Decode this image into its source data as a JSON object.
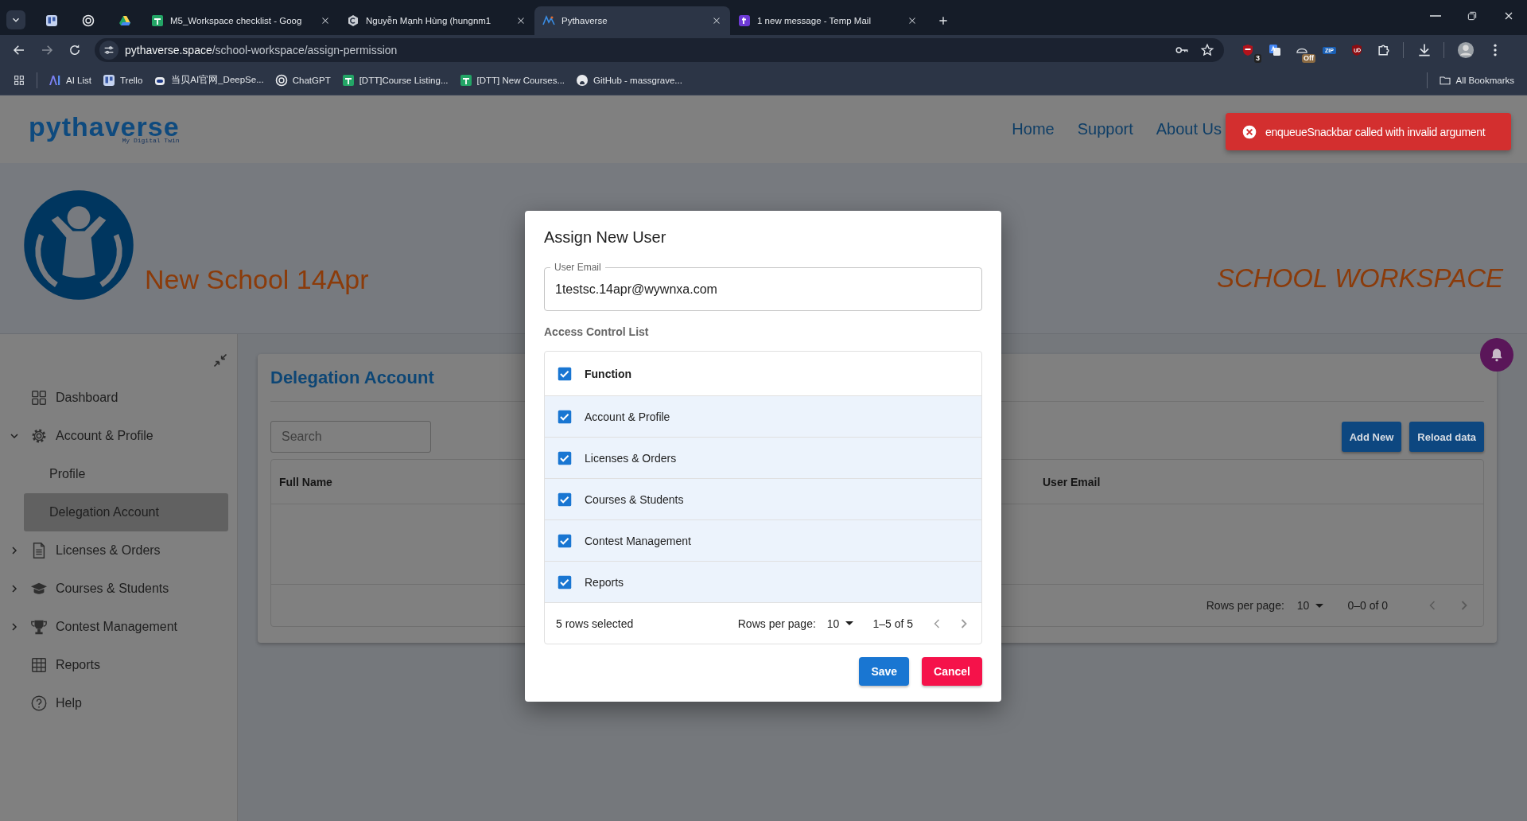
{
  "browser": {
    "tabs": [
      {
        "kind": "pinned",
        "selected": false
      },
      {
        "kind": "pinned",
        "selected": false
      },
      {
        "kind": "pinned",
        "selected": false
      },
      {
        "kind": "page",
        "title": "M5_Workspace checklist - Goog",
        "selected": false
      },
      {
        "kind": "page",
        "title": "Nguyễn Mạnh Hùng (hungnm1",
        "selected": false
      },
      {
        "kind": "page",
        "title": "Pythaverse",
        "selected": true
      },
      {
        "kind": "page",
        "title": "1 new message - Temp Mail",
        "selected": false
      }
    ],
    "address": {
      "host": "pythaverse.space",
      "path": "/school-workspace/assign-permission"
    },
    "extensions": [
      {
        "kind": "counter",
        "text": "3"
      },
      {
        "kind": "plain"
      },
      {
        "kind": "switch",
        "text": "Off"
      },
      {
        "kind": "label",
        "text": "ZIP"
      },
      {
        "kind": "plain"
      }
    ],
    "bookmarks": [
      {
        "title": "AI List"
      },
      {
        "title": "Trello"
      },
      {
        "title": "当贝AI官网_DeepSe..."
      },
      {
        "title": "ChatGPT"
      },
      {
        "title": "[DTT]Course Listing..."
      },
      {
        "title": "[DTT] New Courses..."
      },
      {
        "title": "GitHub - massgrave..."
      }
    ],
    "all_bookmarks": "All Bookmarks"
  },
  "header": {
    "logo": {
      "wordmark": "pythaverse",
      "tagline": "My Digital Twin"
    },
    "nav": [
      {
        "label": "Home"
      },
      {
        "label": "Support"
      },
      {
        "label": "About Us"
      }
    ]
  },
  "snackbar": {
    "message": "enqueueSnackbar called with invalid argument"
  },
  "banner": {
    "school_name": "New School 14Apr",
    "workspace": "SCHOOL WORKSPACE"
  },
  "sidebar": {
    "items": [
      {
        "label": "Dashboard",
        "selected": false
      },
      {
        "label": "Account & Profile",
        "selected": false,
        "expanded": true,
        "children": [
          {
            "label": "Profile",
            "selected": false
          },
          {
            "label": "Delegation Account",
            "selected": true
          }
        ]
      },
      {
        "label": "Licenses & Orders",
        "selected": false,
        "expanded": false
      },
      {
        "label": "Courses & Students",
        "selected": false,
        "expanded": false
      },
      {
        "label": "Contest Management",
        "selected": false,
        "expanded": false
      },
      {
        "label": "Reports",
        "selected": false
      },
      {
        "label": "Help",
        "selected": false
      }
    ]
  },
  "card": {
    "title": "Delegation Account",
    "search": {
      "placeholder": "Search"
    },
    "buttons": [
      "Add New",
      "Reload data"
    ],
    "table": {
      "columns": [
        "Full Name",
        "User Email"
      ],
      "footer": {
        "rows_per_page_label": "Rows per page:",
        "rows_per_page": "10",
        "range": "0–0 of 0"
      }
    }
  },
  "dialog": {
    "title": "Assign New User",
    "email": {
      "label": "User Email",
      "value": "1testsc.14apr@wywnxa.com"
    },
    "acl_title": "Access Control List",
    "table": {
      "header": {
        "label": "Function",
        "checked": true
      },
      "rows": [
        {
          "label": "Account & Profile",
          "selected": true
        },
        {
          "label": "Licenses & Orders",
          "selected": true
        },
        {
          "label": "Courses & Students",
          "selected": true
        },
        {
          "label": "Contest Management",
          "selected": true
        },
        {
          "label": "Reports",
          "selected": true
        }
      ],
      "footer": {
        "selected_count": "5 rows selected",
        "rows_per_page_label": "Rows per page:",
        "rows_per_page": "10",
        "range": "1–5 of 5"
      }
    },
    "buttons": [
      {
        "kind": "primary",
        "label": "Save"
      },
      {
        "kind": "danger",
        "label": "Cancel"
      }
    ]
  }
}
